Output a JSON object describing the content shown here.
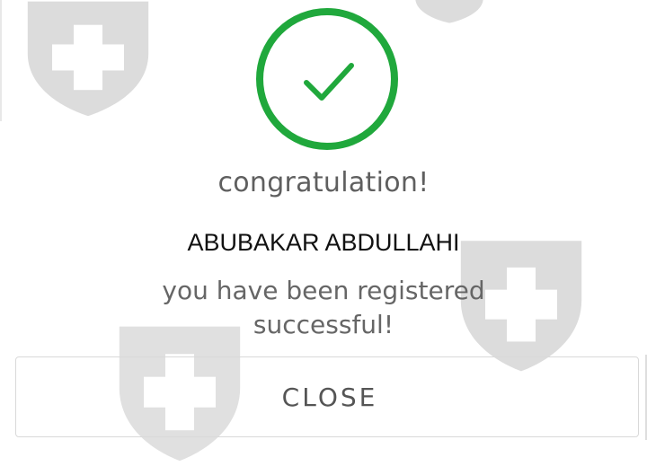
{
  "dialog": {
    "title": "congratulation!",
    "user_name": "ABUBAKAR ABDULLAHI",
    "message": "you have been registered successful!",
    "close_label": "CLOSE"
  },
  "icons": {
    "success": "check-circle-icon",
    "watermark": "shield-cross-icon"
  },
  "colors": {
    "success_green": "#20a83c",
    "title_text": "#5f5f5f",
    "name_text": "#111111",
    "message_text": "#666666",
    "button_border": "#d9d9d9",
    "button_text": "#555555",
    "watermark": "#dcdcdc"
  }
}
